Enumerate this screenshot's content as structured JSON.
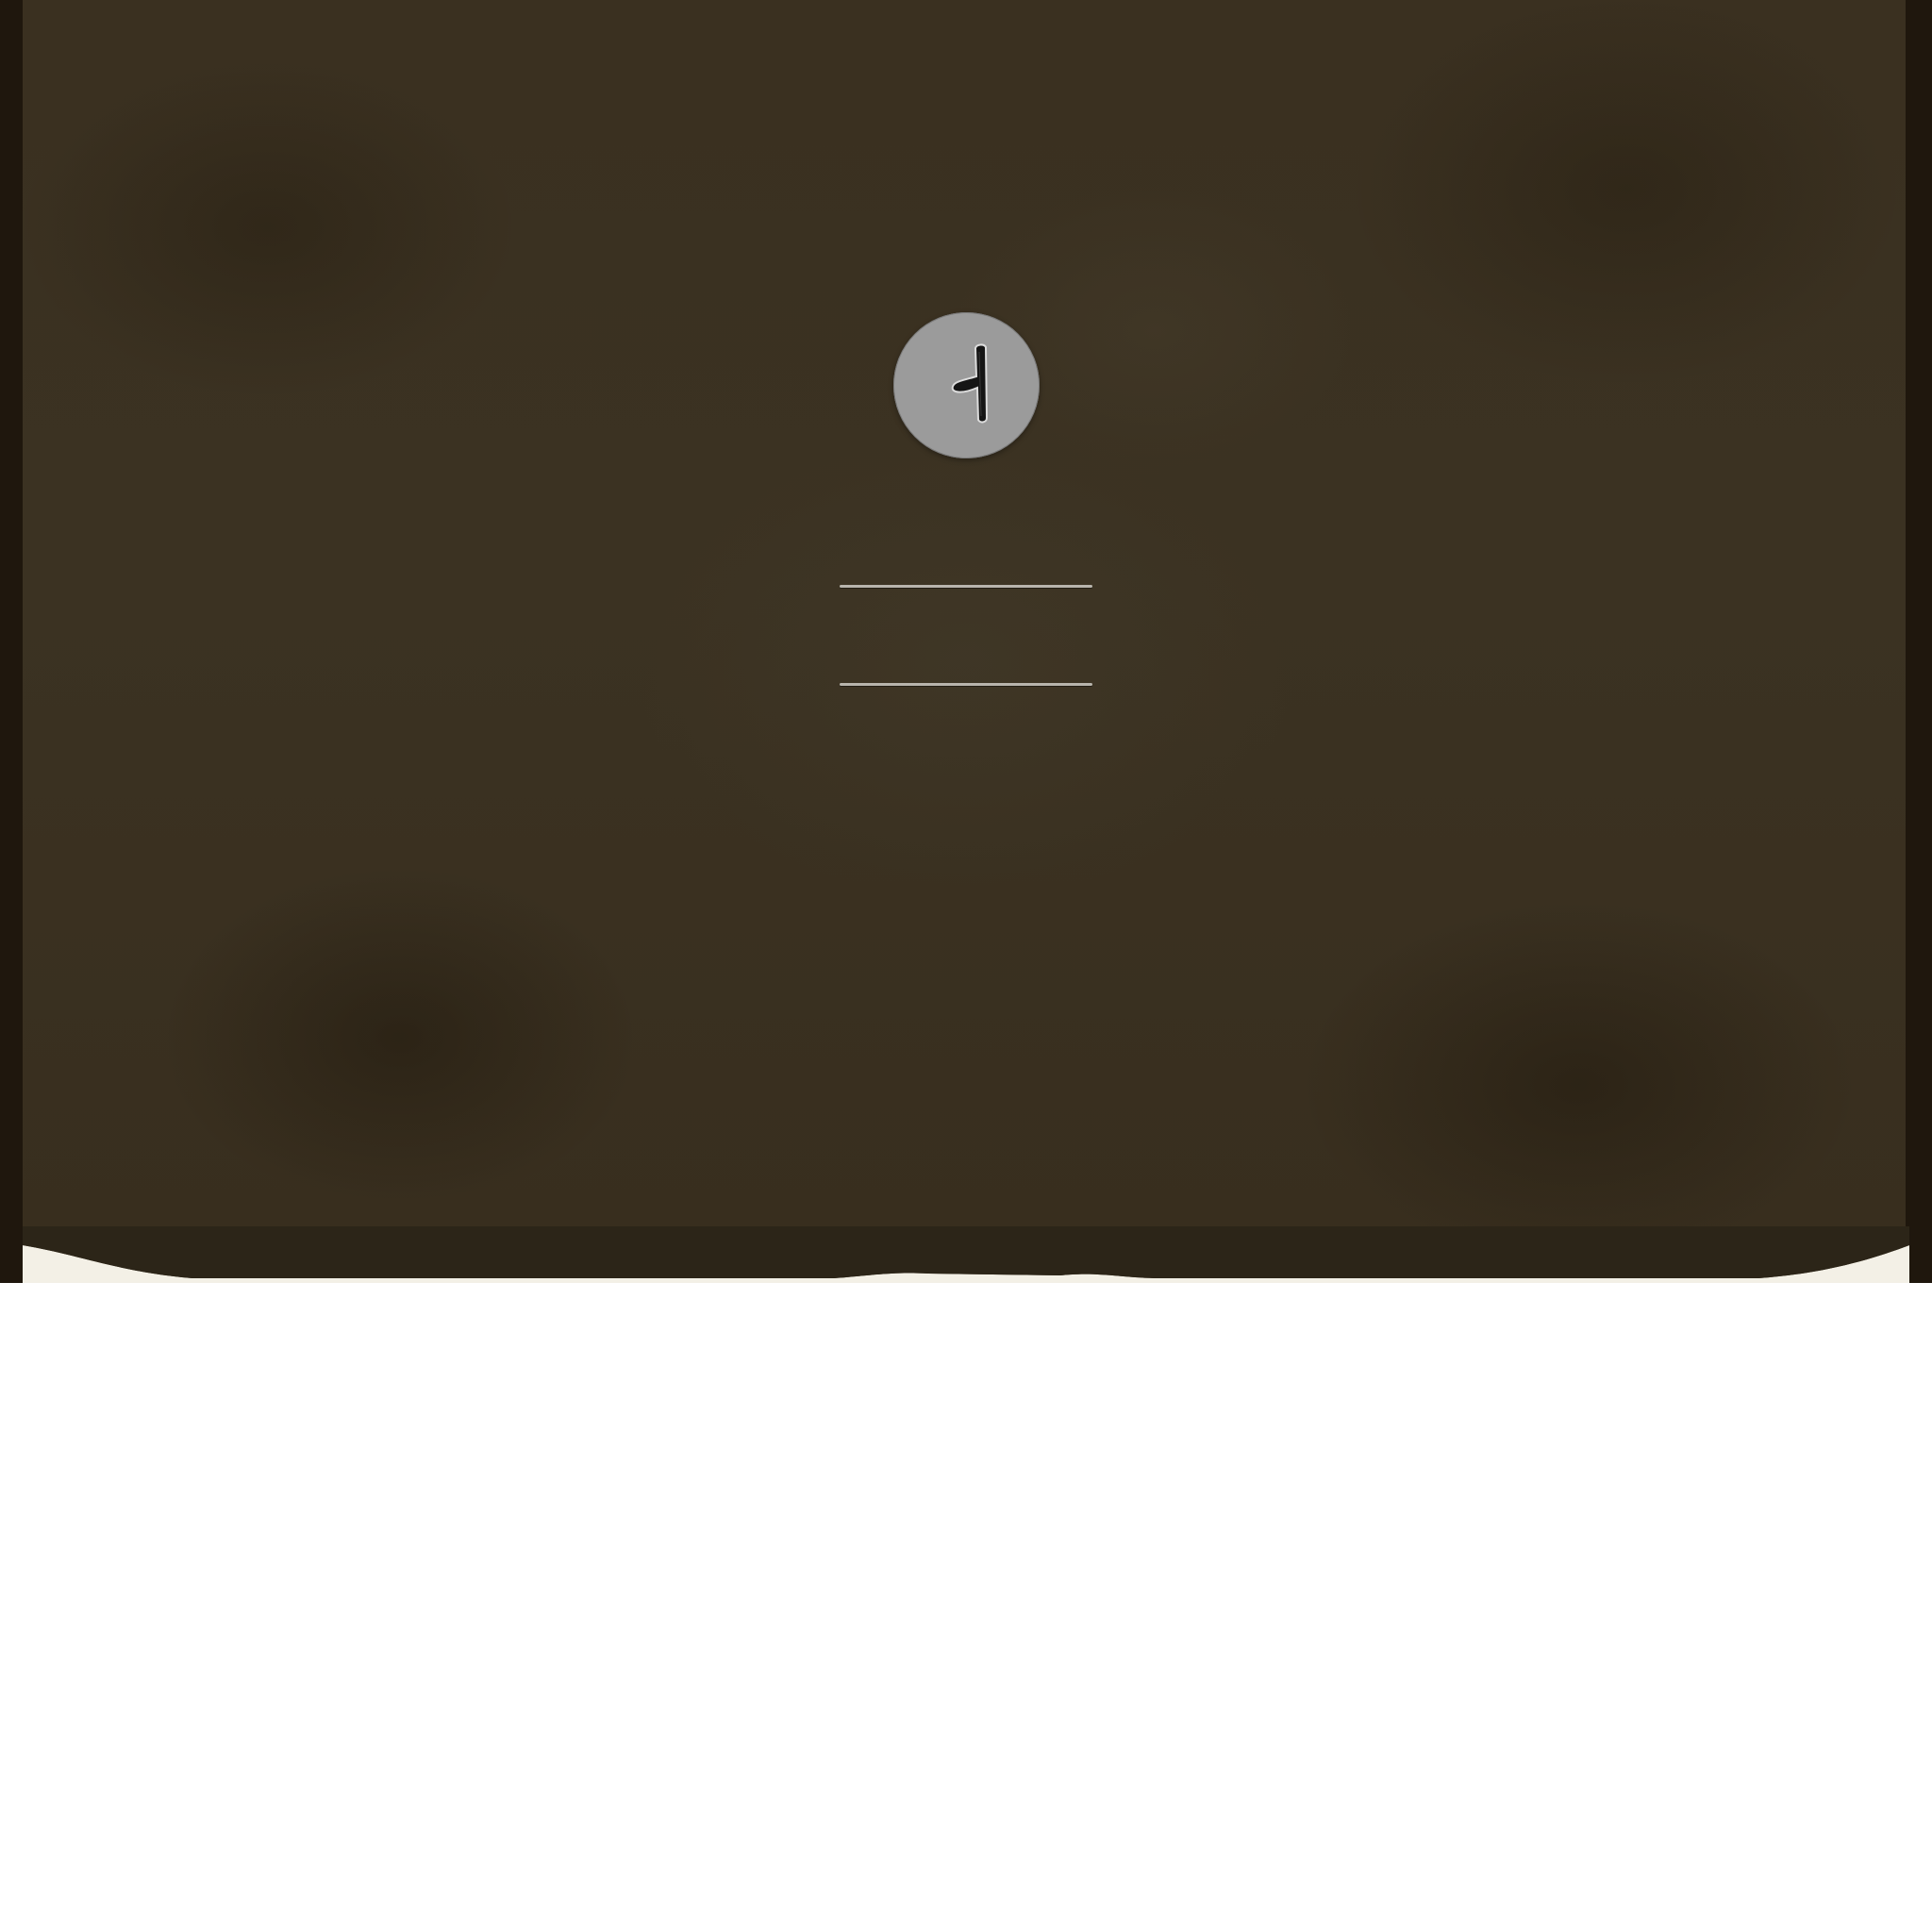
{
  "login": {
    "avatar": {
      "icon": "avatar-glyph-icon",
      "badge_color": "#9b9b9b"
    },
    "username_field": {
      "value": "",
      "placeholder": ""
    },
    "password_field": {
      "value": "",
      "placeholder": ""
    }
  },
  "theme": {
    "panel_color": "#3a3020",
    "frame_color": "#1f170d",
    "line_color": "#b9b5ad"
  }
}
